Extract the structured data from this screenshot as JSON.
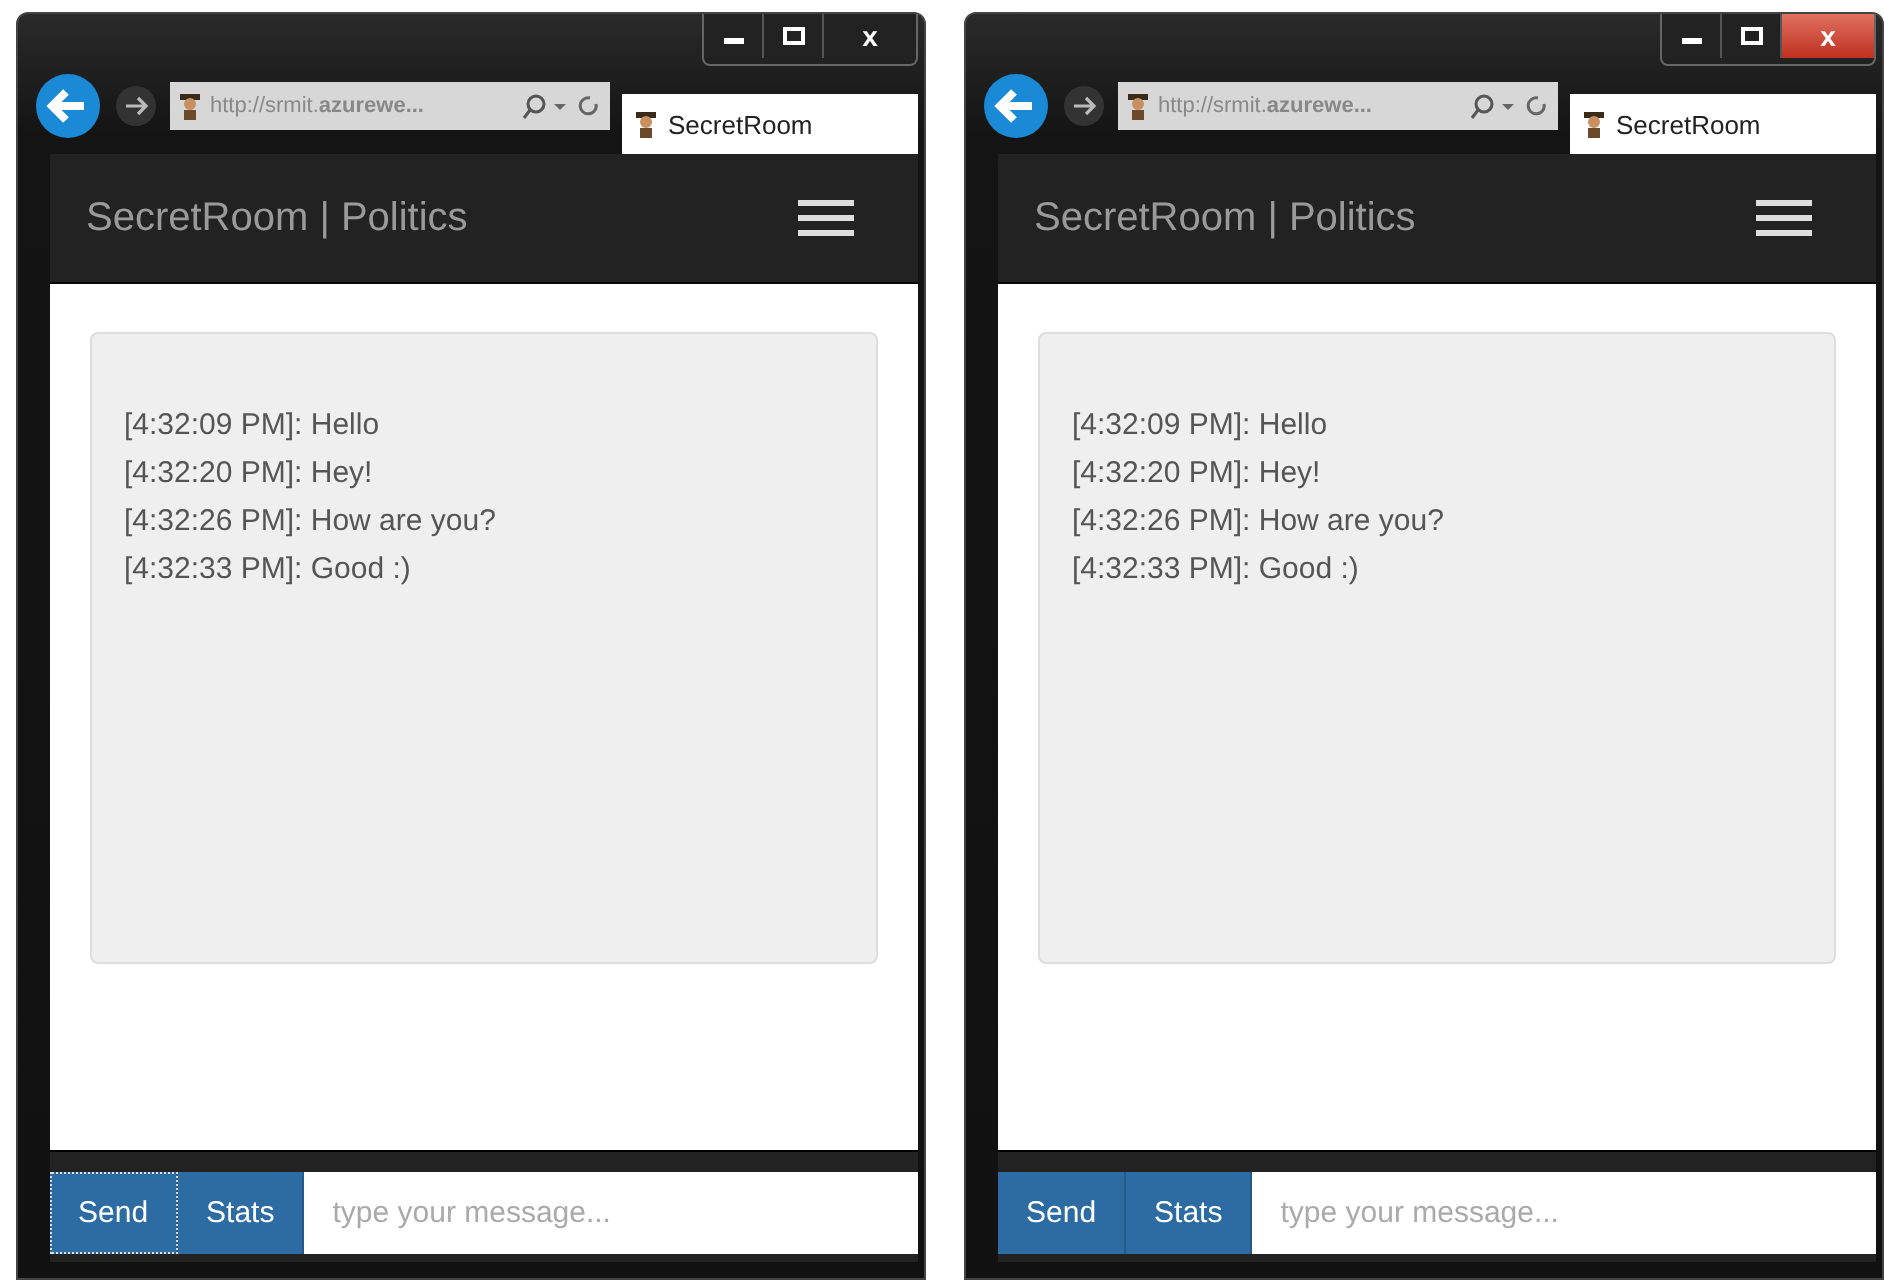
{
  "windows": [
    {
      "active": false,
      "address": "http://srmit.**azurewe...**",
      "tab": "SecretRoom",
      "close_glyph": "x",
      "app_title": "SecretRoom | Politics",
      "messages": [
        "[4:32:09 PM]: Hello",
        "[4:32:20 PM]: Hey!",
        "[4:32:26 PM]: How are you?",
        "[4:32:33 PM]: Good :)"
      ],
      "send": {
        "label": "Send",
        "focused": true
      },
      "stats": "Stats",
      "message_field": {
        "placeholder": "type your message..."
      }
    },
    {
      "active": true,
      "address": "http://srmit.**azurewe...**",
      "tab": "SecretRoom",
      "close_glyph": "x",
      "app_title": "SecretRoom | Politics",
      "messages": [
        "[4:32:09 PM]: Hello",
        "[4:32:20 PM]: Hey!",
        "[4:32:26 PM]: How are you?",
        "[4:32:33 PM]: Good :)"
      ],
      "send": {
        "label": "Send",
        "focused": false
      },
      "stats": "Stats",
      "message_field": {
        "placeholder": "type your message..."
      }
    }
  ]
}
